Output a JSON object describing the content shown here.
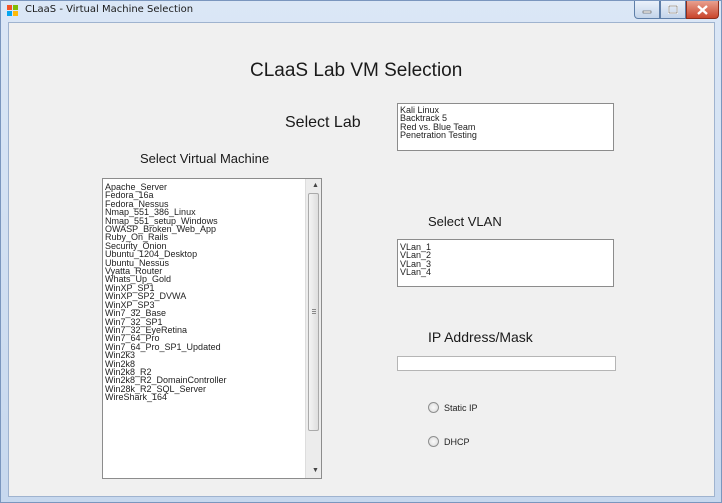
{
  "window": {
    "title": "CLaaS - Virtual Machine Selection",
    "controls": {
      "minimize_icon": "minimize-icon",
      "maximize_icon": "maximize-icon",
      "close_icon": "close-icon"
    }
  },
  "heading": "CLaaS Lab VM Selection",
  "lab": {
    "label": "Select Lab",
    "options": [
      "Kali Linux",
      "Backtrack 5",
      "Red vs. Blue Team",
      "Penetration Testing"
    ]
  },
  "vm": {
    "label": "Select Virtual Machine",
    "options": [
      "Apache_Server",
      "Fedora_16a",
      "Fedora_Nessus",
      "Nmap_551_386_Linux",
      "Nmap_551_setup_Windows",
      "OWASP_Broken_Web_App",
      "Ruby_On_Rails",
      "Security_Onion",
      "Ubuntu_1204_Desktop",
      "Ubuntu_Nessus",
      "Vyatta_Router",
      "Whats_Up_Gold",
      "WinXP_SP1",
      "WinXP_SP2_DVWA",
      "WinXP_SP3",
      "Win7_32_Base",
      "Win7_32_SP1",
      "Win7_32_EyeRetina",
      "Win7_64_Pro",
      "Win7_64_Pro_SP1_Updated",
      "Win2k3",
      "Win2k8",
      "Win2k8_R2",
      "Win2k8_R2_DomainController",
      "Win28k_R2_SQL_Server",
      "WireShark_164"
    ]
  },
  "vlan": {
    "label": "Select VLAN",
    "options": [
      "VLan_1",
      "VLan_2",
      "VLan_3",
      "VLan_4"
    ]
  },
  "ip": {
    "label": "IP Address/Mask",
    "value": ""
  },
  "radios": {
    "static_label": "Static IP",
    "dhcp_label": "DHCP"
  },
  "colors": {
    "title_bar": "#c9d9ee",
    "client_bg": "#f0f0f0",
    "close_button": "#c9452c"
  }
}
